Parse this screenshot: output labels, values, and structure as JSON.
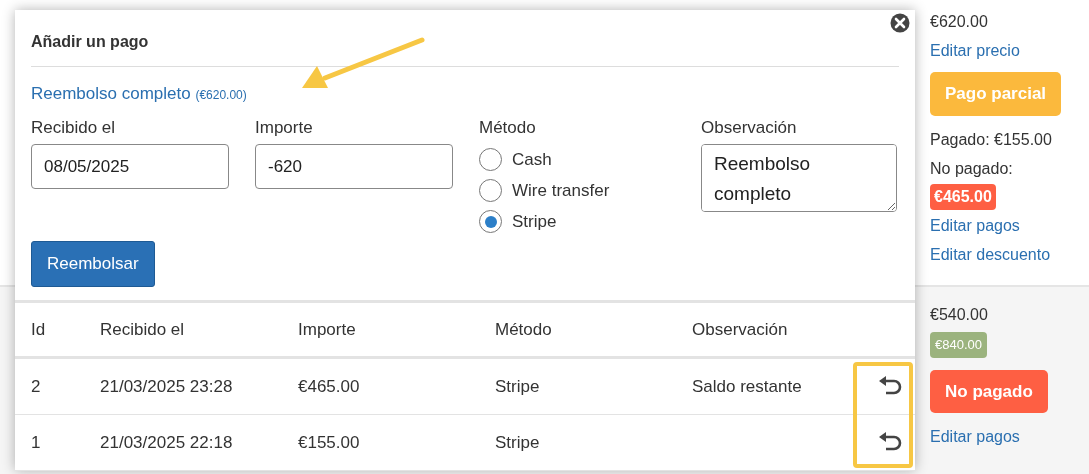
{
  "popup": {
    "title": "Añadir un pago",
    "refund_link": {
      "text": "Reembolso completo",
      "amount": "(€620.00)"
    },
    "fields": [
      {
        "label": "Recibido el",
        "value": "08/05/2025"
      },
      {
        "label": "Importe",
        "value": "-620"
      }
    ],
    "method": {
      "label": "Método",
      "options": [
        {
          "label": "Cash",
          "selected": false
        },
        {
          "label": "Wire transfer",
          "selected": false
        },
        {
          "label": "Stripe",
          "selected": true
        }
      ]
    },
    "note": {
      "label": "Observación",
      "value": "Reembolso completo"
    },
    "submit": "Reembolsar",
    "table": {
      "columns": [
        "Id",
        "Recibido el",
        "Importe",
        "Método",
        "Observación"
      ],
      "rows": [
        {
          "cells": [
            "2",
            "21/03/2025 23:28",
            "€465.00",
            "Stripe",
            "Saldo restante"
          ]
        },
        {
          "cells": [
            "1",
            "21/03/2025 22:18",
            "€155.00",
            "Stripe",
            ""
          ]
        }
      ]
    }
  },
  "orders": [
    {
      "items": [
        {
          "kind": "text",
          "text": "€620.00"
        },
        {
          "kind": "link",
          "text": "Editar precio"
        },
        {
          "kind": "status",
          "text": "Pago parcial",
          "color": "#fbb93d"
        },
        {
          "kind": "text",
          "text": "Pagado: €155.00"
        },
        {
          "kind": "text",
          "text": "No pagado:"
        },
        {
          "kind": "badge",
          "text": "€465.00",
          "color": "#fe5f43"
        },
        {
          "kind": "link",
          "text": "Editar pagos"
        },
        {
          "kind": "link",
          "text": "Editar descuento"
        }
      ]
    },
    {
      "items": [
        {
          "kind": "text",
          "text": "€540.00"
        },
        {
          "kind": "badge",
          "text": "€840.00",
          "color": "#9bb37e"
        },
        {
          "kind": "status",
          "text": "No pagado",
          "color": "#fe5f43"
        },
        {
          "kind": "link",
          "text": "Editar pagos"
        }
      ]
    }
  ],
  "annotations": {
    "arrow": true,
    "highlight": true
  }
}
